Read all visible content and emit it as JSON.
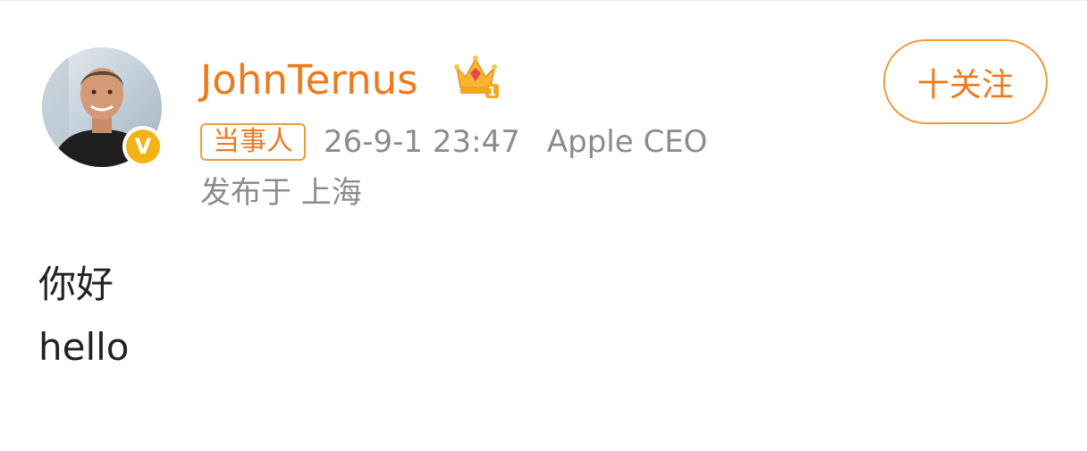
{
  "post": {
    "author": {
      "name": "JohnTernus",
      "avatar": "avatar-photo",
      "verified_badge": "V",
      "crown_icon": "crown-icon",
      "crown_rank": "1"
    },
    "follow_button_label": "十关注",
    "tag_label": "当事人",
    "timestamp": "26-9-1 23:47",
    "source": "Apple CEO",
    "location": "发布于 上海",
    "content_lines": [
      "你好",
      "hello"
    ]
  },
  "colors": {
    "accent": "#ee7a1c",
    "secondary_text": "#8c8c8c",
    "body_text": "#222222",
    "verified": "#f6b214"
  }
}
